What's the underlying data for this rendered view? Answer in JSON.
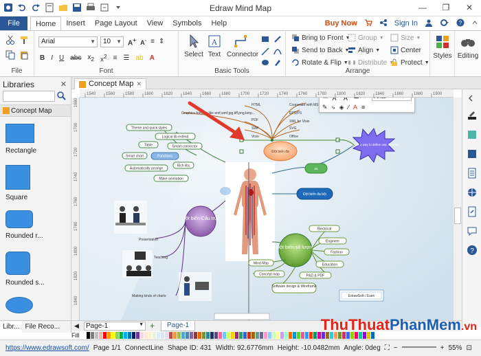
{
  "window": {
    "title": "Edraw Mind Map"
  },
  "tabs": {
    "file": "File",
    "items": [
      "Home",
      "Insert",
      "Page Layout",
      "View",
      "Symbols",
      "Help"
    ],
    "buy_now": "Buy Now",
    "sign_in": "Sign In"
  },
  "ribbon": {
    "file_label": "File",
    "font_label": "Font",
    "font_name": "Arial",
    "font_size": "10",
    "basic_tools_label": "Basic Tools",
    "select": "Select",
    "text": "Text",
    "connector": "Connector",
    "arrange_label": "Arrange",
    "bring_front": "Bring to Front",
    "send_back": "Send to Back",
    "rotate_flip": "Rotate & Flip",
    "group": "Group",
    "align": "Align",
    "distribute": "Distribute",
    "size": "Size",
    "center": "Center",
    "protect": "Protect",
    "styles": "Styles",
    "editing": "Editing"
  },
  "libraries": {
    "title": "Libraries",
    "category": "Concept Map",
    "shapes": [
      "Rectangle",
      "Square",
      "Rounded r...",
      "Rounded s..."
    ],
    "bottom_tabs": [
      "Libr...",
      "File Reco..."
    ]
  },
  "document": {
    "tab": "Concept Map",
    "page_tab": "Page-1",
    "page_active": "Page-1",
    "fill_label": "Fill"
  },
  "ruler_h": [
    "1540",
    "1560",
    "1580",
    "1600",
    "1620",
    "1640",
    "1660",
    "1680",
    "1700",
    "1720",
    "1740",
    "1760",
    "1780",
    "1800",
    "1820",
    "1840",
    "1860",
    "1880",
    "1900"
  ],
  "ruler_v": [
    "1680",
    "1700",
    "1720",
    "1740",
    "1760",
    "1780",
    "1800",
    "1820",
    "1840"
  ],
  "floating_toolbar": {
    "font": "Arial"
  },
  "mindmap": {
    "center_label": "Đột biến đa",
    "center_sub": "Đột biến đa dòng",
    "left_branch": "Đột biến Cấu trúc",
    "right_branch": "Đột biến số lượng",
    "star": "Provide a way to define own libraries",
    "pill_green": "ss",
    "pill_blue": "Đột biến đa bội",
    "top_leaves": [
      "HTML",
      "Graphics formats like emf,wmf,jpg,tiff,png,bmp...",
      "PDF",
      "SWF",
      "SVG",
      "EPS/PS",
      "XML for Visio",
      "Office",
      "Cooperate with MS",
      "Visio"
    ],
    "left_leaves": [
      "Theme and quick styles",
      "Logical lib extend",
      "Table",
      "Smart connector",
      "Smart chart",
      "Functions",
      "Rich libs",
      "Automatically arrange",
      "Make animation"
    ],
    "people_labels": [
      "Presentation",
      "Teaching",
      "Making kinds of charts"
    ],
    "right_leaves": [
      "Electrical",
      "Engineer",
      "Fashion",
      "Education",
      "P&D & PDF",
      "Software design & Wireframe",
      "Concept map",
      "Mind Map"
    ],
    "credit": "EdrawSoft / Even"
  },
  "status": {
    "link": "https://www.edrawsoft.com/",
    "page": "Page 1/1",
    "shape_type": "ConnectLine",
    "shape_id": "Shape ID: 431",
    "width": "Width: 92.6776mm",
    "height": "Height: -10.0482mm",
    "angle": "Angle: 0deg",
    "zoom": "55%"
  },
  "watermark": {
    "part1": "ThuThuat",
    "part2": "PhanMem",
    "part3": ".vn"
  },
  "colors": {
    "accent": "#2b5797",
    "canvas": "#dce9f2",
    "buy": "#d04a10",
    "wm_red": "#e0241b",
    "wm_blue": "#1a5fb4"
  },
  "palette": [
    "#ffffff",
    "#000000",
    "#7f7f7f",
    "#c0c0c0",
    "#e6b8b7",
    "#ff0000",
    "#ff9900",
    "#ffff00",
    "#92d050",
    "#00b050",
    "#00b0f0",
    "#0070c0",
    "#002060",
    "#7030a0",
    "#f2dcdb",
    "#fde9d9",
    "#fff2cc",
    "#ebf1de",
    "#dbeef3",
    "#dce6f1",
    "#e4dfec",
    "#c0504d",
    "#f79646",
    "#9bbb59",
    "#4bacc6",
    "#4f81bd",
    "#8064a2",
    "#953734",
    "#e36c09",
    "#76923c",
    "#31859c",
    "#17375e",
    "#5f497a",
    "#ff6699",
    "#66ccff",
    "#ccff66",
    "#ffcc00",
    "#993366",
    "#339966",
    "#3366cc",
    "#cc3300",
    "#996600",
    "#669999",
    "#666699",
    "#ff99cc",
    "#99ccff",
    "#ccffcc",
    "#ffff99",
    "#cc99ff",
    "#99ffcc",
    "#ff6600",
    "#0099cc",
    "#66cc33",
    "#cc6699",
    "#3399ff",
    "#ff3300",
    "#009966",
    "#cc0099",
    "#6633cc",
    "#996633",
    "#33cccc",
    "#ff9966",
    "#669933",
    "#cc3366",
    "#3366ff",
    "#99cc00",
    "#ff0066",
    "#00cc99",
    "#9900cc",
    "#cccc00",
    "#0066cc"
  ]
}
